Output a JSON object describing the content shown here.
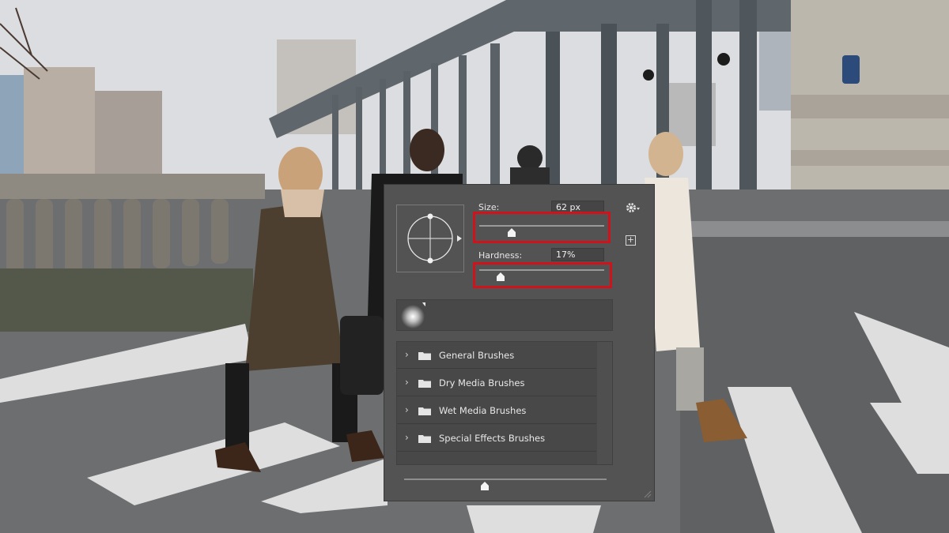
{
  "brush_panel": {
    "size_label": "Size:",
    "size_value": "62 px",
    "size_slider_fraction": 0.26,
    "hardness_label": "Hardness:",
    "hardness_value": "17%",
    "hardness_slider_fraction": 0.17,
    "highlight_color": "#d0121b",
    "gear_icon": "gear-icon",
    "new_preset_icon": "plus-box-icon",
    "new_preset_glyph": "+",
    "folders": [
      {
        "label": "General Brushes",
        "chevron": "›"
      },
      {
        "label": "Dry Media Brushes",
        "chevron": "›"
      },
      {
        "label": "Wet Media Brushes",
        "chevron": "›"
      },
      {
        "label": "Special Effects Brushes",
        "chevron": "›"
      }
    ],
    "preview_size_fraction": 0.4
  },
  "colors": {
    "panel_bg": "#535353",
    "list_bg": "#484848",
    "text": "#e6e6e6"
  }
}
